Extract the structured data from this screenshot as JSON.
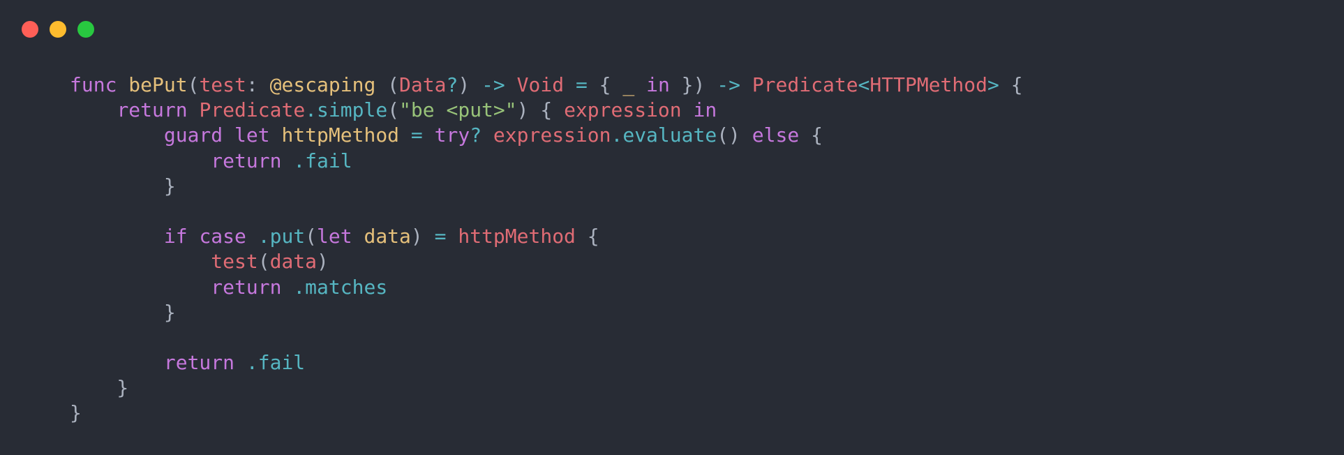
{
  "window": {
    "controls": [
      {
        "name": "close",
        "color": "#ff5f57"
      },
      {
        "name": "minimize",
        "color": "#febc2e"
      },
      {
        "name": "zoom",
        "color": "#28c840"
      }
    ]
  },
  "theme": {
    "background": "#282c35",
    "plain": "#abb2bf",
    "keyword": "#c678dd",
    "function": "#e5c07b",
    "type": "#e06c75",
    "operator": "#56b6c2",
    "string": "#98c379",
    "attr": "#e5c07b",
    "variable": "#e5c07b",
    "member": "#56b6c2"
  },
  "code": {
    "language": "swift",
    "lines": [
      [
        {
          "t": "func",
          "k": "keyword"
        },
        {
          "t": " ",
          "k": "plain"
        },
        {
          "t": "bePut",
          "k": "function"
        },
        {
          "t": "(",
          "k": "plain"
        },
        {
          "t": "test",
          "k": "type"
        },
        {
          "t": ": ",
          "k": "plain"
        },
        {
          "t": "@escaping",
          "k": "attr"
        },
        {
          "t": " (",
          "k": "plain"
        },
        {
          "t": "Data",
          "k": "type"
        },
        {
          "t": "?",
          "k": "operator"
        },
        {
          "t": ") ",
          "k": "plain"
        },
        {
          "t": "->",
          "k": "operator"
        },
        {
          "t": " ",
          "k": "plain"
        },
        {
          "t": "Void",
          "k": "type"
        },
        {
          "t": " ",
          "k": "plain"
        },
        {
          "t": "=",
          "k": "operator"
        },
        {
          "t": " { ",
          "k": "plain"
        },
        {
          "t": "_",
          "k": "function"
        },
        {
          "t": " ",
          "k": "plain"
        },
        {
          "t": "in",
          "k": "keyword"
        },
        {
          "t": " }) ",
          "k": "plain"
        },
        {
          "t": "->",
          "k": "operator"
        },
        {
          "t": " ",
          "k": "plain"
        },
        {
          "t": "Predicate",
          "k": "type"
        },
        {
          "t": "<",
          "k": "operator"
        },
        {
          "t": "HTTPMethod",
          "k": "type"
        },
        {
          "t": ">",
          "k": "operator"
        },
        {
          "t": " {",
          "k": "plain"
        }
      ],
      [
        {
          "t": "    ",
          "k": "plain"
        },
        {
          "t": "return",
          "k": "keyword"
        },
        {
          "t": " ",
          "k": "plain"
        },
        {
          "t": "Predicate",
          "k": "type"
        },
        {
          "t": ".simple",
          "k": "member"
        },
        {
          "t": "(",
          "k": "plain"
        },
        {
          "t": "\"be <put>\"",
          "k": "string"
        },
        {
          "t": ") { ",
          "k": "plain"
        },
        {
          "t": "expression",
          "k": "type"
        },
        {
          "t": " ",
          "k": "plain"
        },
        {
          "t": "in",
          "k": "keyword"
        }
      ],
      [
        {
          "t": "        ",
          "k": "plain"
        },
        {
          "t": "guard",
          "k": "keyword"
        },
        {
          "t": " ",
          "k": "plain"
        },
        {
          "t": "let",
          "k": "keyword"
        },
        {
          "t": " ",
          "k": "plain"
        },
        {
          "t": "httpMethod",
          "k": "variable"
        },
        {
          "t": " ",
          "k": "plain"
        },
        {
          "t": "=",
          "k": "operator"
        },
        {
          "t": " ",
          "k": "plain"
        },
        {
          "t": "try",
          "k": "keyword"
        },
        {
          "t": "?",
          "k": "operator"
        },
        {
          "t": " ",
          "k": "plain"
        },
        {
          "t": "expression",
          "k": "type"
        },
        {
          "t": ".evaluate",
          "k": "member"
        },
        {
          "t": "() ",
          "k": "plain"
        },
        {
          "t": "else",
          "k": "keyword"
        },
        {
          "t": " {",
          "k": "plain"
        }
      ],
      [
        {
          "t": "            ",
          "k": "plain"
        },
        {
          "t": "return",
          "k": "keyword"
        },
        {
          "t": " ",
          "k": "plain"
        },
        {
          "t": ".fail",
          "k": "member"
        }
      ],
      [
        {
          "t": "        }",
          "k": "plain"
        }
      ],
      [
        {
          "t": "",
          "k": "plain"
        }
      ],
      [
        {
          "t": "        ",
          "k": "plain"
        },
        {
          "t": "if",
          "k": "keyword"
        },
        {
          "t": " ",
          "k": "plain"
        },
        {
          "t": "case",
          "k": "keyword"
        },
        {
          "t": " ",
          "k": "plain"
        },
        {
          "t": ".put",
          "k": "member"
        },
        {
          "t": "(",
          "k": "plain"
        },
        {
          "t": "let",
          "k": "keyword"
        },
        {
          "t": " ",
          "k": "plain"
        },
        {
          "t": "data",
          "k": "variable"
        },
        {
          "t": ") ",
          "k": "plain"
        },
        {
          "t": "=",
          "k": "operator"
        },
        {
          "t": " ",
          "k": "plain"
        },
        {
          "t": "httpMethod",
          "k": "type"
        },
        {
          "t": " {",
          "k": "plain"
        }
      ],
      [
        {
          "t": "            ",
          "k": "plain"
        },
        {
          "t": "test",
          "k": "type"
        },
        {
          "t": "(",
          "k": "plain"
        },
        {
          "t": "data",
          "k": "type"
        },
        {
          "t": ")",
          "k": "plain"
        }
      ],
      [
        {
          "t": "            ",
          "k": "plain"
        },
        {
          "t": "return",
          "k": "keyword"
        },
        {
          "t": " ",
          "k": "plain"
        },
        {
          "t": ".matches",
          "k": "member"
        }
      ],
      [
        {
          "t": "        }",
          "k": "plain"
        }
      ],
      [
        {
          "t": "",
          "k": "plain"
        }
      ],
      [
        {
          "t": "        ",
          "k": "plain"
        },
        {
          "t": "return",
          "k": "keyword"
        },
        {
          "t": " ",
          "k": "plain"
        },
        {
          "t": ".fail",
          "k": "member"
        }
      ],
      [
        {
          "t": "    }",
          "k": "plain"
        }
      ],
      [
        {
          "t": "}",
          "k": "plain"
        }
      ]
    ]
  }
}
